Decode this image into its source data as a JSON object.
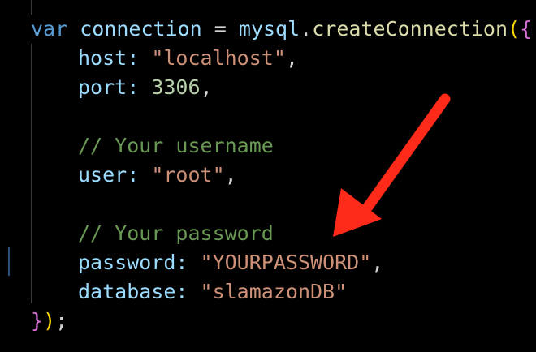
{
  "code": {
    "line1": {
      "kw": "var",
      "name": "connection",
      "op": " = ",
      "obj": "mysql",
      "dot": ".",
      "fn": "createConnection",
      "paren": "(",
      "brace": "{"
    },
    "line2": {
      "key": "host",
      "colon": ": ",
      "value": "\"localhost\"",
      "comma": ","
    },
    "line3": {
      "key": "port",
      "colon": ": ",
      "value": "3306",
      "comma": ","
    },
    "line4": {
      "comment": "// Your username"
    },
    "line5": {
      "key": "user",
      "colon": ": ",
      "value": "\"root\"",
      "comma": ","
    },
    "line6": {
      "comment": "// Your password"
    },
    "line7": {
      "key": "password",
      "colon": ": ",
      "value": "\"YOURPASSWORD\"",
      "comma": ","
    },
    "line8": {
      "key": "database",
      "colon": ": ",
      "value": "\"slamazonDB\""
    },
    "line9": {
      "brace": "}",
      "paren": ")",
      "semi": ";"
    }
  },
  "annotation": {
    "arrow_color": "#ff2a1a",
    "arrow_icon": "red-arrow-icon"
  }
}
